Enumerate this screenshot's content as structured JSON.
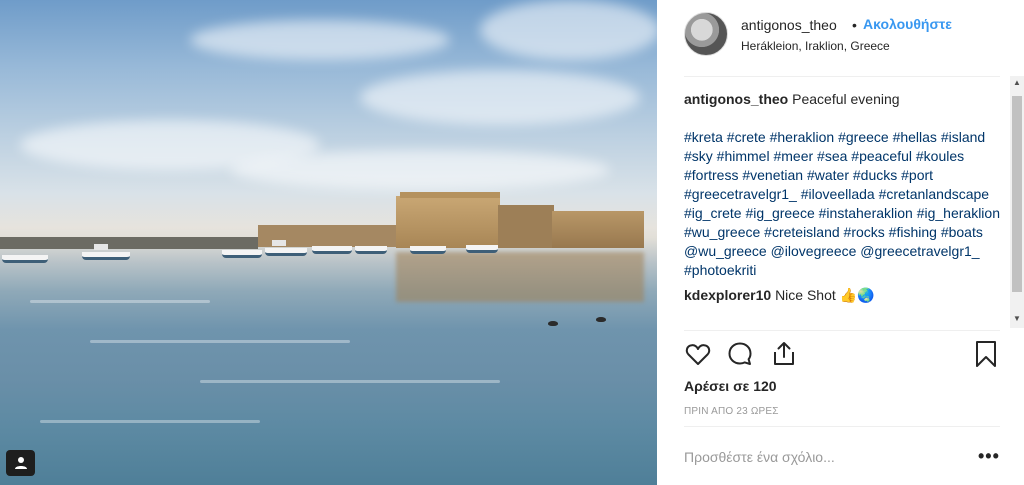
{
  "post": {
    "username": "antigonos_theo",
    "separator": "•",
    "follow_label": "Ακολουθήστε",
    "location": "Herákleion, Iraklion, Greece"
  },
  "comments": {
    "caption_user": "antigonos_theo",
    "caption_text": "Peaceful evening",
    "hashtags": "#kreta #crete #heraklion #greece #hellas #island #sky #himmel #meer #sea #peaceful #koules #fortress #venetian #water #ducks #port #greecetravelgr1_ #iloveellada #cretanlandscape #ig_crete #ig_greece #instaheraklion #ig_heraklion #wu_greece #creteisland #rocks #fishing #boats @wu_greece @ilovegreece @greecetravelgr1_ #photoekriti",
    "comment2_user": "kdexplorer10",
    "comment2_text": "Nice Shot",
    "comment2_emoji": "👍🌏"
  },
  "actions": {
    "likes": "Αρέσει σε 120",
    "time": "ΠΡΙΝ ΑΠΟ 23 ΩΡΕΣ"
  },
  "compose": {
    "placeholder": "Προσθέστε ένα σχόλιο...",
    "more_label": "•••"
  },
  "scrollbar": {
    "up_arrow": "▲",
    "down_arrow": "▼"
  },
  "icons": {
    "heart": "heart-icon",
    "comment": "comment-icon",
    "share": "share-icon",
    "bookmark": "bookmark-icon",
    "tagged_user": "user-tag-icon"
  },
  "colors": {
    "link_blue": "#3897f0",
    "hashtag": "#003569",
    "muted": "#999999"
  }
}
